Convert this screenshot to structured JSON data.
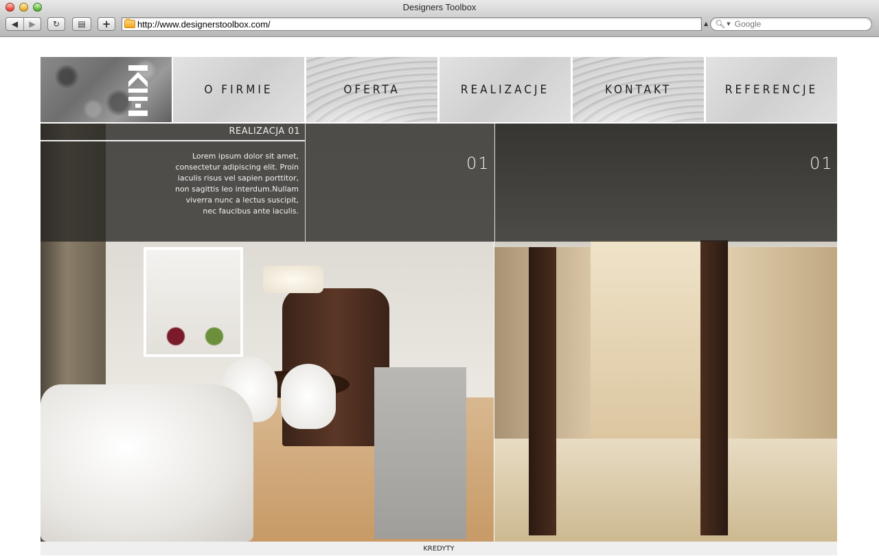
{
  "browser": {
    "title": "Designers Toolbox",
    "url": "http://www.designerstoolbox.com/",
    "search_placeholder": "Google"
  },
  "nav": {
    "items": [
      {
        "label": "O FIRMIE",
        "style": "plain"
      },
      {
        "label": "OFERTA",
        "style": "wave"
      },
      {
        "label": "REALIZACJE",
        "style": "plain"
      },
      {
        "label": "KONTAKT",
        "style": "wave"
      },
      {
        "label": "REFERENCJE",
        "style": "plain"
      }
    ]
  },
  "hero": {
    "caption_title": "REALIZACJA 01",
    "caption_body": "Lorem ipsum dolor sit amet, consectetur adipiscing elit. Proin iaculis risus vel sapien porttitor, non sagittis leo interdum.Nullam viverra nunc a lectus suscipit, nec faucibus ante iaculis.",
    "slide_numbers": [
      "01",
      "01"
    ]
  },
  "footer": {
    "label": "KREDYTY"
  },
  "colors": {
    "overlay": "#2a2826",
    "nav_text": "#1a1a1a",
    "caption_text": "#f0f0f0"
  }
}
